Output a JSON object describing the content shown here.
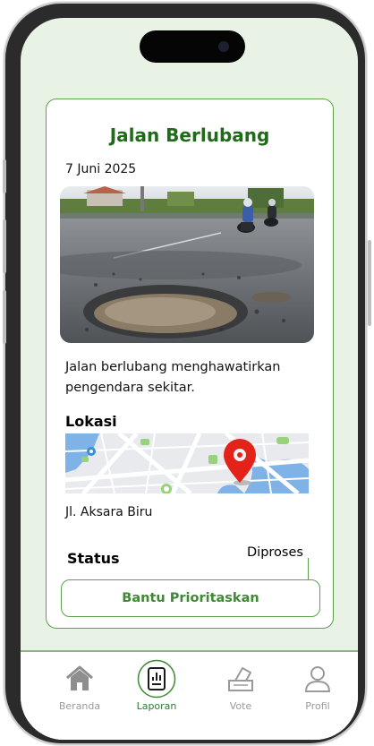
{
  "report": {
    "title": "Jalan Berlubang",
    "date": "7 Juni 2025",
    "description": "Jalan berlubang menghawatirkan pengendara sekitar.",
    "location_heading": "Lokasi",
    "address": "Jl. Aksara Biru",
    "status_label": "Status",
    "status_value": "Diproses",
    "cta_label": "Bantu Prioritaskan"
  },
  "nav": {
    "items": [
      {
        "label": "Beranda",
        "icon": "home-icon",
        "active": false
      },
      {
        "label": "Laporan",
        "icon": "report-icon",
        "active": true
      },
      {
        "label": "Vote",
        "icon": "ballot-icon",
        "active": false
      },
      {
        "label": "Profil",
        "icon": "user-icon",
        "active": false
      }
    ]
  },
  "colors": {
    "accent": "#1f6b19",
    "border": "#5da04e",
    "screen_bg": "#e8f3e6",
    "pin": "#e32219"
  }
}
